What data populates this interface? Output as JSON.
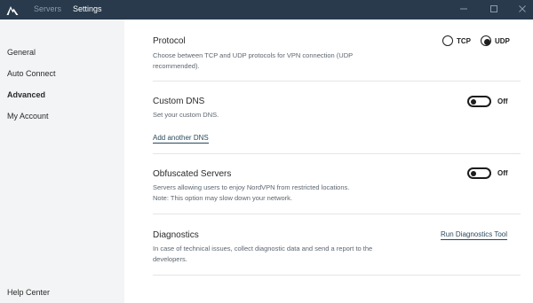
{
  "titlebar": {
    "tabs": [
      {
        "label": "Servers"
      },
      {
        "label": "Settings"
      }
    ]
  },
  "sidebar": {
    "items": [
      {
        "label": "General"
      },
      {
        "label": "Auto Connect"
      },
      {
        "label": "Advanced"
      },
      {
        "label": "My Account"
      }
    ],
    "help_label": "Help Center"
  },
  "protocol": {
    "title": "Protocol",
    "description_line1": "Choose between TCP and UDP protocols for VPN connection (UDP",
    "description_line2": "recommended).",
    "options": [
      {
        "label": "TCP"
      },
      {
        "label": "UDP"
      }
    ],
    "selected": "UDP"
  },
  "custom_dns": {
    "title": "Custom DNS",
    "description": "Set your custom DNS.",
    "link": "Add another DNS",
    "toggle_label": "Off"
  },
  "obfuscated": {
    "title": "Obfuscated Servers",
    "description_line1": "Servers allowing users to enjoy NordVPN from restricted locations.",
    "description_line2": "Note: This option may slow down your network.",
    "toggle_label": "Off"
  },
  "diagnostics": {
    "title": "Diagnostics",
    "description_line1": "In case of technical issues, collect diagnostic data and send a report to the",
    "description_line2": "developers.",
    "link": "Run Diagnostics Tool"
  },
  "colors": {
    "titlebar_bg": "#283a4c",
    "sidebar_bg": "#f3f4f5",
    "link": "#2b4a5e"
  }
}
